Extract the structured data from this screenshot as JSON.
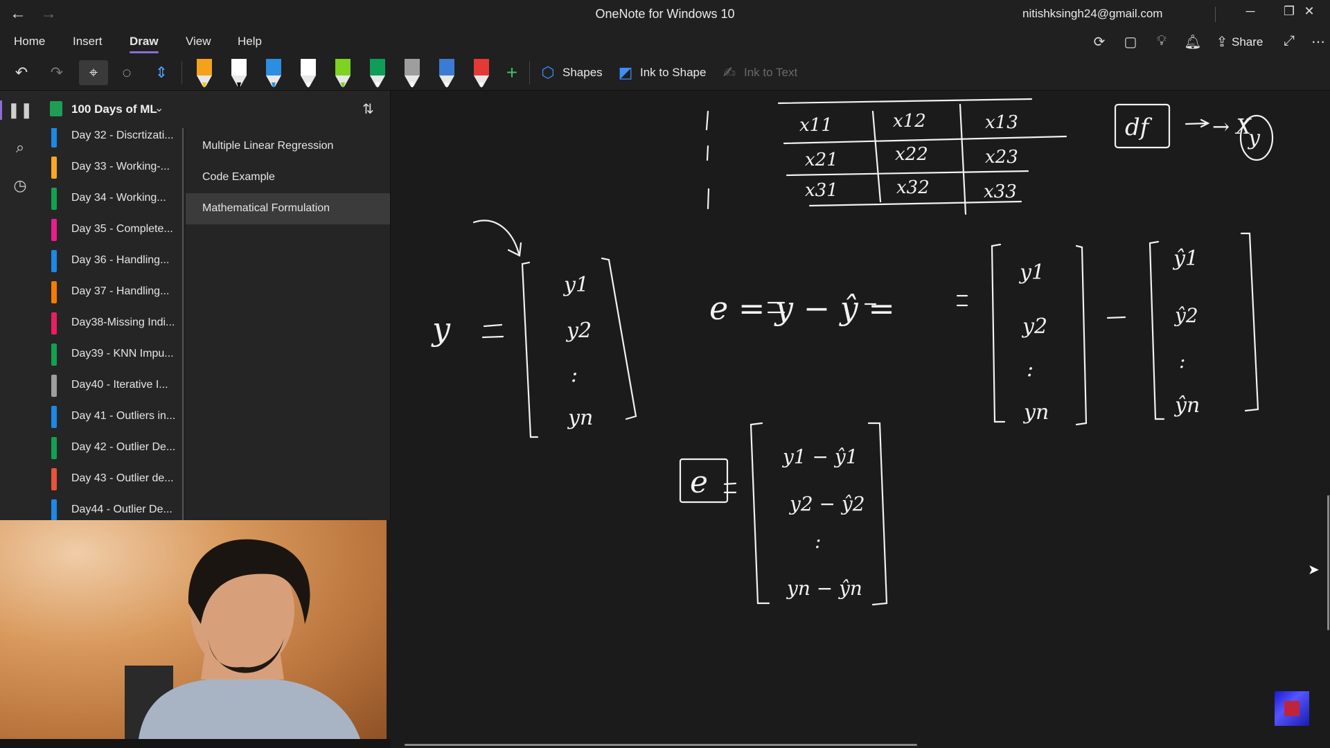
{
  "window": {
    "title": "OneNote for Windows 10",
    "account": "nitishksingh24@gmail.com"
  },
  "ribbon": {
    "tabs": [
      {
        "label": "Home"
      },
      {
        "label": "Insert"
      },
      {
        "label": "Draw",
        "active": true
      },
      {
        "label": "View"
      },
      {
        "label": "Help"
      }
    ],
    "share_label": "Share"
  },
  "toolbar": {
    "shapes_label": "Shapes",
    "ink_to_shape_label": "Ink to Shape",
    "ink_to_text_label": "Ink to Text",
    "pens": [
      {
        "color": "#f4a21c",
        "tip": "#f0c800"
      },
      {
        "color": "#ffffff",
        "tip": "#000000"
      },
      {
        "color": "#2d8de0",
        "tip": "#2d8de0"
      },
      {
        "color": "#ffffff",
        "tip": "#ffffff"
      },
      {
        "color": "#7cd321",
        "tip": "#7cd321"
      },
      {
        "color": "#0f9d58",
        "tip": "#ffffff"
      },
      {
        "color": "#9e9e9e",
        "tip": "#ffffff"
      },
      {
        "color": "#3b7bd4",
        "tip": "#ffffff"
      },
      {
        "color": "#e53935",
        "tip": "#ffffff"
      }
    ]
  },
  "notebook": {
    "name": "100 Days of ML",
    "sections": [
      {
        "label": "Day 32 - Discrtizati...",
        "color": "#1e88e5"
      },
      {
        "label": "Day 33 - Working-...",
        "color": "#f9a825"
      },
      {
        "label": "Day 34 - Working...",
        "color": "#12a150"
      },
      {
        "label": "Day 35 - Complete...",
        "color": "#e91e8c"
      },
      {
        "label": "Day 36 - Handling...",
        "color": "#1e88e5"
      },
      {
        "label": "Day 37 - Handling...",
        "color": "#f57c00"
      },
      {
        "label": "Day38-Missing Indi...",
        "color": "#e91e63"
      },
      {
        "label": "Day39 - KNN Impu...",
        "color": "#12a150"
      },
      {
        "label": "Day40 - Iterative I...",
        "color": "#9e9e9e"
      },
      {
        "label": "Day 41 - Outliers in...",
        "color": "#1e88e5"
      },
      {
        "label": "Day 42 - Outlier De...",
        "color": "#12a150"
      },
      {
        "label": "Day 43 - Outlier de...",
        "color": "#e8533a"
      },
      {
        "label": "Day44 - Outlier De...",
        "color": "#1e88e5"
      }
    ],
    "pages": [
      {
        "label": "Multiple Linear Regression"
      },
      {
        "label": "Code Example"
      },
      {
        "label": "Mathematical Formulation",
        "selected": true
      }
    ]
  },
  "ink": {
    "table_cells": [
      [
        "x11",
        "x12",
        "x13"
      ],
      [
        "x21",
        "x22",
        "x23"
      ],
      [
        "x31",
        "x32",
        "x33"
      ]
    ],
    "df_label": "df",
    "arrow_text": "→ X",
    "y_circled": "y",
    "y_eq_lhs": "y",
    "y_vector": [
      "y1",
      "y2",
      ":",
      "yn"
    ],
    "e_lhs": "e = y − ŷ =",
    "y_vector_2": [
      "y1",
      "y2",
      ":",
      "yn"
    ],
    "minus": "−",
    "yhat_vector": [
      "ŷ1",
      "ŷ2",
      ":",
      "ŷn"
    ],
    "e_boxed": "e",
    "diff_vector": [
      "y1 − ŷ1",
      "y2 − ŷ2",
      ":",
      "yn − ŷn"
    ]
  }
}
